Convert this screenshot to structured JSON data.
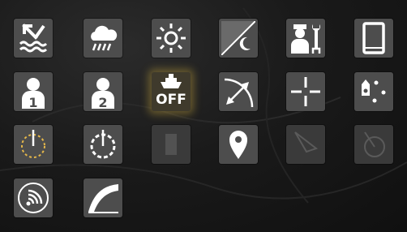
{
  "tiles": {
    "screen_shift": {
      "icon": "screen-shift-icon"
    },
    "weather": {
      "icon": "weather-rain-icon"
    },
    "brightness": {
      "icon": "brightness-icon"
    },
    "day_night": {
      "icon": "day-night-icon"
    },
    "service": {
      "icon": "service-technician-icon"
    },
    "tablet": {
      "icon": "tablet-icon"
    },
    "user_1": {
      "icon": "user-profile-icon",
      "number": "1"
    },
    "user_2": {
      "icon": "user-profile-icon",
      "number": "2"
    },
    "autopilot_off": {
      "icon": "boat-autopilot-icon",
      "label": "OFF"
    },
    "measure": {
      "icon": "measure-range-icon"
    },
    "crosshair": {
      "icon": "crosshair-icon"
    },
    "waypoint_route": {
      "icon": "route-points-icon"
    },
    "range_ring": {
      "icon": "range-ring-icon"
    },
    "timer_ring": {
      "icon": "timer-ring-icon"
    },
    "disabled_tool": {
      "icon": "disabled-tool-icon"
    },
    "location_pin": {
      "icon": "location-pin-icon"
    },
    "trail_disabled": {
      "icon": "trail-icon"
    },
    "compass_disabled": {
      "icon": "compass-icon"
    },
    "sonar": {
      "icon": "sonar-icon"
    },
    "curve": {
      "icon": "curve-icon"
    }
  },
  "colors": {
    "tile": "#4d4d4d",
    "tile_dim": "#3a3a3a",
    "icon": "#ffffff",
    "glow": "#c8a43c"
  }
}
